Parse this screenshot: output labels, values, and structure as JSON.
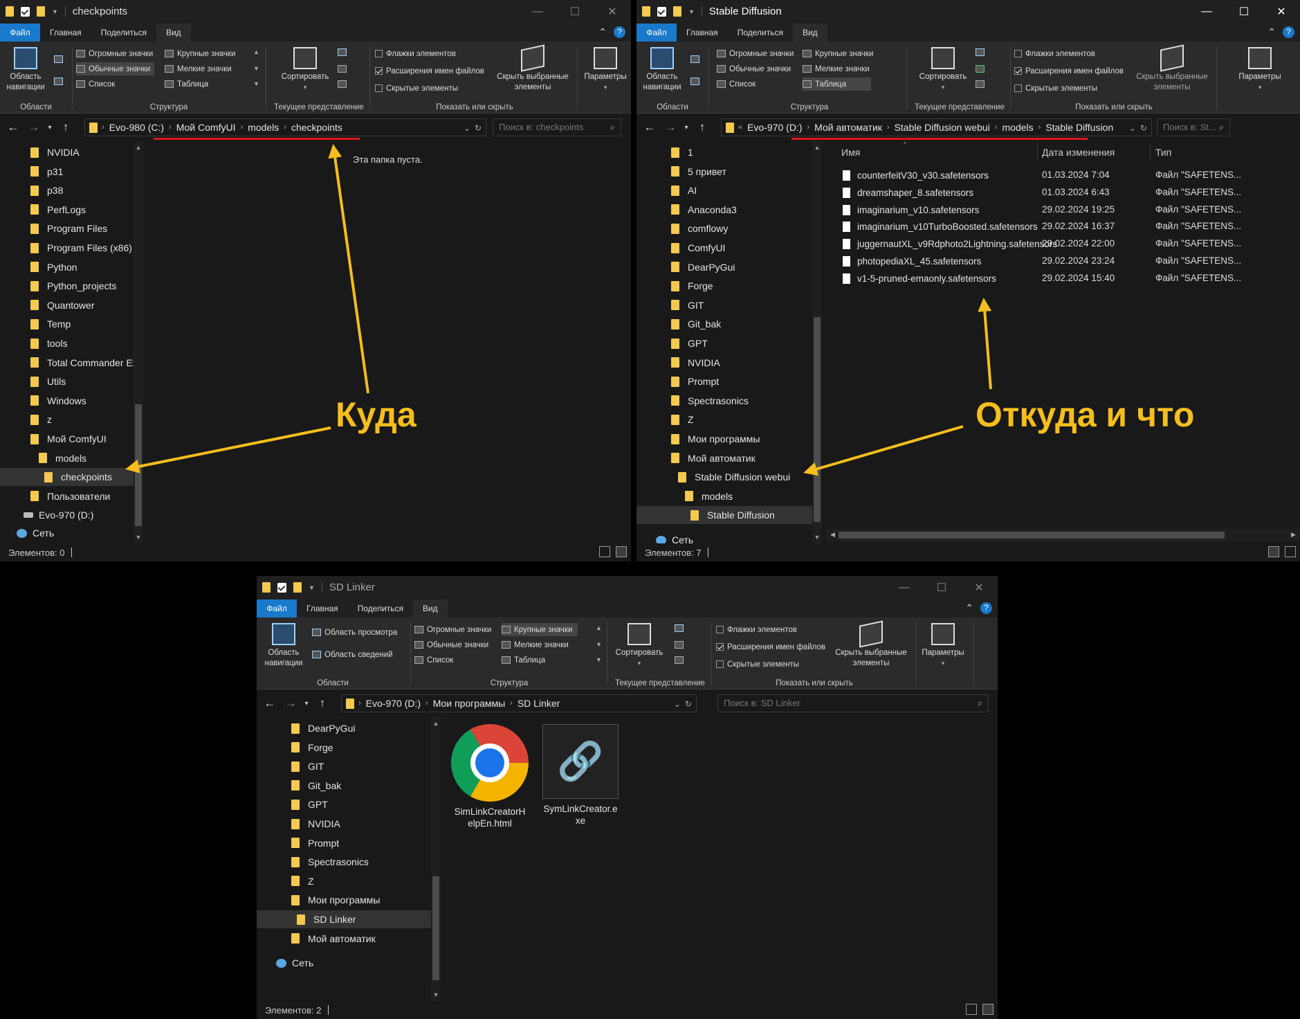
{
  "ribbon_common": {
    "tab_file": "Файл",
    "tab_home": "Главная",
    "tab_share": "Поделиться",
    "tab_view": "Вид",
    "nav_pane": "Область\nнавигации",
    "huge_icons": "Огромные значки",
    "large_icons": "Крупные значки",
    "normal_icons": "Обычные значки",
    "small_icons": "Мелкие значки",
    "list": "Список",
    "table": "Таблица",
    "sort": "Сортировать",
    "item_checkboxes": "Флажки элементов",
    "file_ext": "Расширения имен файлов",
    "hidden_items": "Скрытые элементы",
    "hide_selected": "Скрыть выбранные\nэлементы",
    "options": "Параметры",
    "group_areas": "Области",
    "group_structure": "Структура",
    "group_current_view": "Текущее представление",
    "group_show_hide": "Показать или скрыть",
    "preview_pane": "Область просмотра",
    "details_pane": "Область сведений"
  },
  "win1": {
    "title": "checkpoints",
    "breadcrumb": [
      "Evo-980 (C:)",
      "Мой ComfyUI",
      "models",
      "checkpoints"
    ],
    "search_placeholder": "Поиск в: checkpoints",
    "empty_text": "Эта папка пуста.",
    "nav_items": [
      "NVIDIA",
      "p31",
      "p38",
      "PerfLogs",
      "Program Files",
      "Program Files (x86)",
      "Python",
      "Python_projects",
      "Quantower",
      "Temp",
      "tools",
      "Total Commander Ex",
      "Utils",
      "Windows",
      "z",
      "Мой ComfyUI",
      "models",
      "checkpoints",
      "Пользователи"
    ],
    "drive": "Evo-970 (D:)",
    "network": "Сеть",
    "status": "Элементов: 0"
  },
  "win2": {
    "title": "Stable Diffusion",
    "breadcrumb": [
      "Evo-970 (D:)",
      "Мой автоматик",
      "Stable Diffusion webui",
      "models",
      "Stable Diffusion"
    ],
    "search_placeholder": "Поиск в: St...",
    "nav_items": [
      "1",
      "5 привет",
      "AI",
      "Anaconda3",
      "comflowy",
      "ComfyUI",
      "DearPyGui",
      "Forge",
      "GIT",
      "Git_bak",
      "GPT",
      "NVIDIA",
      "Prompt",
      "Spectrasonics",
      "Z",
      "Мои программы",
      "Мой автоматик",
      "Stable Diffusion webui",
      "models",
      "Stable Diffusion"
    ],
    "network": "Сеть",
    "columns": {
      "name": "Имя",
      "date": "Дата изменения",
      "type": "Тип"
    },
    "files": [
      {
        "name": "counterfeitV30_v30.safetensors",
        "date": "01.03.2024 7:04",
        "type": "Файл \"SAFETENS..."
      },
      {
        "name": "dreamshaper_8.safetensors",
        "date": "01.03.2024 6:43",
        "type": "Файл \"SAFETENS..."
      },
      {
        "name": "imaginarium_v10.safetensors",
        "date": "29.02.2024 19:25",
        "type": "Файл \"SAFETENS..."
      },
      {
        "name": "imaginarium_v10TurboBoosted.safetensors",
        "date": "29.02.2024 16:37",
        "type": "Файл \"SAFETENS..."
      },
      {
        "name": "juggernautXL_v9Rdphoto2Lightning.safetensors",
        "date": "29.02.2024 22:00",
        "type": "Файл \"SAFETENS..."
      },
      {
        "name": "photopediaXL_45.safetensors",
        "date": "29.02.2024 23:24",
        "type": "Файл \"SAFETENS..."
      },
      {
        "name": "v1-5-pruned-emaonly.safetensors",
        "date": "29.02.2024 15:40",
        "type": "Файл \"SAFETENS..."
      }
    ],
    "status": "Элементов: 7"
  },
  "win3": {
    "title": "SD Linker",
    "breadcrumb": [
      "Evo-970 (D:)",
      "Мои программы",
      "SD Linker"
    ],
    "search_placeholder": "Поиск в: SD Linker",
    "nav_items": [
      "DearPyGui",
      "Forge",
      "GIT",
      "Git_bak",
      "GPT",
      "NVIDIA",
      "Prompt",
      "Spectrasonics",
      "Z",
      "Мои программы",
      "SD Linker",
      "Мой автоматик"
    ],
    "network": "Сеть",
    "items": [
      {
        "name": "SimLinkCreatorHelpEn.html",
        "line1": "SimLinkCreatorH",
        "line2": "elpEn.html"
      },
      {
        "name": "SymLinkCreator.exe",
        "line1": "SymLinkCreator.e",
        "line2": "xe"
      }
    ],
    "status": "Элементов: 2"
  },
  "annotations": {
    "where_to": "Куда",
    "from_and_what": "Откуда и что"
  },
  "colors": {
    "accent": "#1979ca",
    "annotation": "#f5be1e",
    "underline": "#e0141e",
    "folder": "#f3c94f"
  }
}
